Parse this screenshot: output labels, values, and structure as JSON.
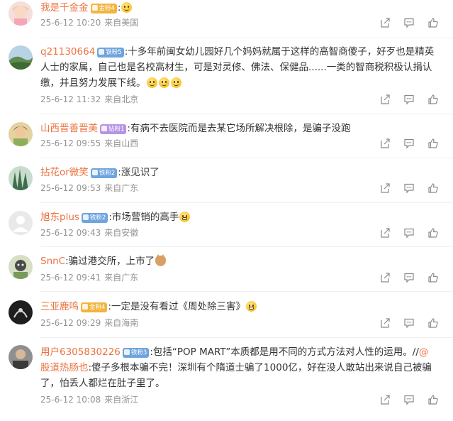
{
  "comments": [
    {
      "username": "我是千金金",
      "badge": "金粉4",
      "sep": ":",
      "text": "",
      "emojis": [
        "grin"
      ],
      "date": "25-6-12 10:20",
      "location": "来自美国"
    },
    {
      "username": "q21130664",
      "badge": "铁粉5",
      "sep": ":",
      "text": "十多年前闽女幼儿园好几个妈妈就属于这样的高智商傻子，好歹也是精英人士的家属，自己也是名校高材生，可是对灵修、佛法、保健品......一类的智商税积极认捐认缴，并且努力发展下线。",
      "emojis": [
        "grin",
        "grin",
        "grin"
      ],
      "date": "25-6-12 11:32",
      "location": "来自北京"
    },
    {
      "username": "山西晋善晋美",
      "badge": "钻粉1",
      "sep": ":",
      "text": "有病不去医院而是去某它场所解决根除，是骗子没跑",
      "emojis": [],
      "date": "25-6-12 09:55",
      "location": "来自山西"
    },
    {
      "username": "拈花or微笑",
      "badge": "铁粉2",
      "sep": ":",
      "text": "涨见识了",
      "emojis": [],
      "date": "25-6-12 09:53",
      "location": "来自广东"
    },
    {
      "username": "旭东plus",
      "badge": "铁粉2",
      "sep": ":",
      "text": "市场营销的高手",
      "emojis": [
        "teeth"
      ],
      "date": "25-6-12 09:43",
      "location": "来自安徽"
    },
    {
      "username": "SnnC",
      "badge": "",
      "sep": ":",
      "text": "骗过港交所，上市了",
      "emojis": [
        "cat"
      ],
      "date": "25-6-12 09:41",
      "location": "来自广东"
    },
    {
      "username": "三亚鹿鸣",
      "badge": "金粉4",
      "sep": ":",
      "text": "一定是没有看过《周处除三害》",
      "emojis": [
        "teeth"
      ],
      "date": "25-6-12 09:29",
      "location": "来自海南"
    },
    {
      "username": "用户6305830226",
      "badge": "铁粉3",
      "sep": ":",
      "text": "包括“POP MART”本质都是用不同的方式方法对人性的运用。//",
      "mention": "@股道热肠也",
      "text2": ":傻子多根本骗不完！深圳有个隋道士骗了1000亿，好在没人敢站出来说自己被骗了，怕丢人都烂在肚子里了。",
      "emojis": [],
      "date": "25-6-12 10:08",
      "location": "来自浙江"
    }
  ],
  "colors": {
    "username": "#eb7340",
    "meta": "#939393",
    "iron_badge": "#6fa4dd",
    "gold_badge": "#f2b43c",
    "diamond_badge": "#b793e6"
  },
  "icons": {
    "share": "share-icon",
    "comment": "comment-icon",
    "like": "like-icon"
  }
}
